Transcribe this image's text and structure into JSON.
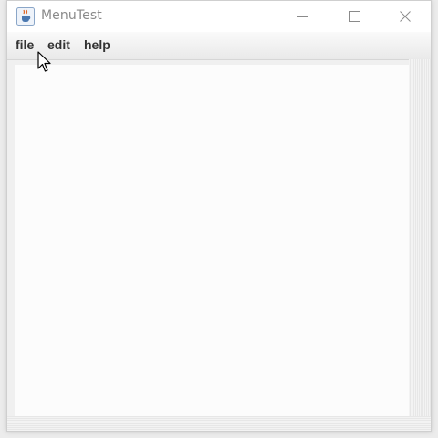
{
  "window": {
    "title": "MenuTest"
  },
  "icons": {
    "app": "java-coffee-icon",
    "minimize": "minimize-icon",
    "maximize": "maximize-icon",
    "close": "close-icon",
    "cursor": "mouse-pointer-icon"
  },
  "menubar": {
    "items": [
      {
        "label": "file"
      },
      {
        "label": "edit"
      },
      {
        "label": "help"
      }
    ]
  },
  "colors": {
    "title_text": "#8a8a8a",
    "menu_text": "#333333",
    "content_bg": "#fcfcfc"
  }
}
